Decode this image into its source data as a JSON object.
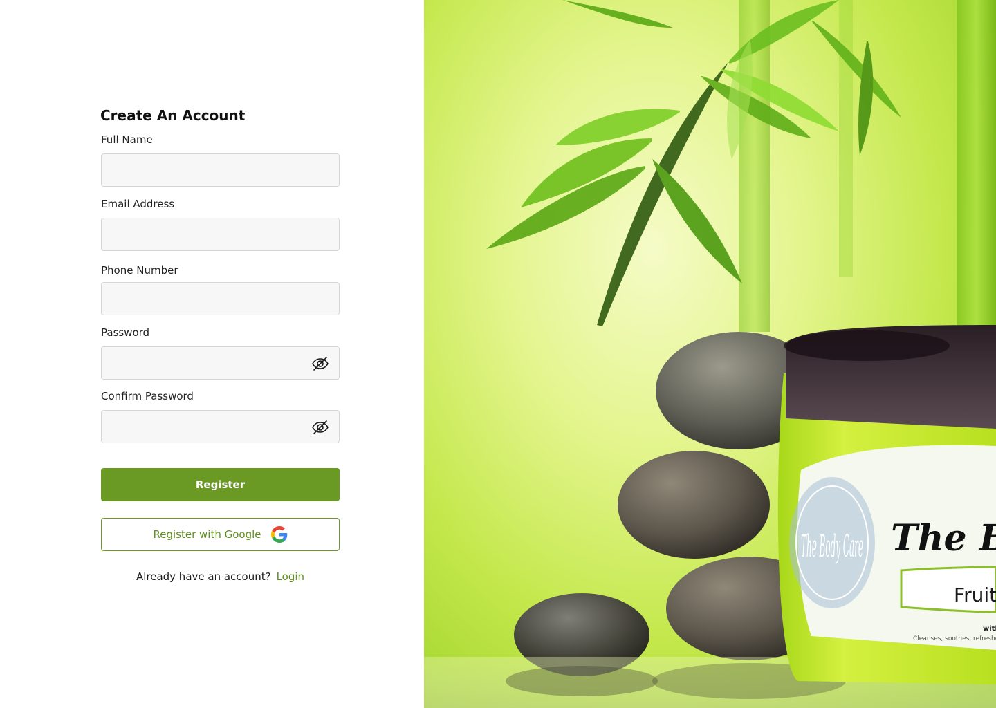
{
  "form": {
    "title": "Create An Account",
    "fields": [
      {
        "label": "Full Name",
        "value": "",
        "placeholder": ""
      },
      {
        "label": "Email Address",
        "value": "",
        "placeholder": ""
      },
      {
        "label": "Phone Number",
        "value": "",
        "placeholder": ""
      },
      {
        "label": "Password",
        "value": "",
        "placeholder": ""
      },
      {
        "label": "Confirm Password",
        "value": "",
        "placeholder": ""
      }
    ],
    "register_label": "Register",
    "google_label": "Register with Google",
    "login_prompt": "Already have an account?",
    "login_label": "Login"
  },
  "hero": {
    "brand_title_partial": "The Bo",
    "brand_logo_text": "The Body Care",
    "product_subtitle_partial": "Fruit F",
    "tagline_partial": "Cleanses, soothes, refreshes and",
    "side_partial": "with Fr"
  },
  "colors": {
    "accent": "#6a9a23",
    "link": "#5f8f1e"
  },
  "icons": {
    "password_toggle": "eye-off-icon",
    "google": "google-icon"
  }
}
